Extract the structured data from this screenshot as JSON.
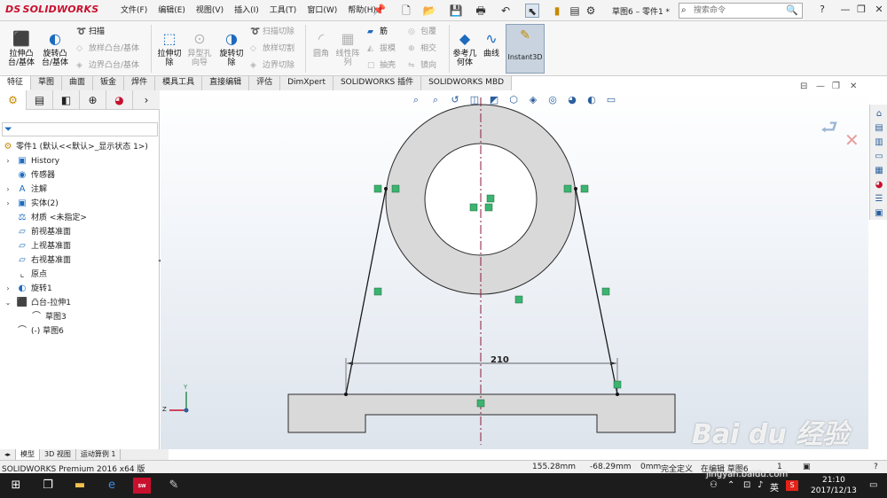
{
  "app": {
    "logo_text": "SOLIDWORKS",
    "doc_title": "草图6 – 零件1 *",
    "accent": "#c8102e"
  },
  "menu": [
    "文件(F)",
    "编辑(E)",
    "视图(V)",
    "插入(I)",
    "工具(T)",
    "窗口(W)",
    "帮助(H)"
  ],
  "search": {
    "placeholder": "搜索命令"
  },
  "ribbon": {
    "extrude_boss": "拉伸凸\n台/基体",
    "revolve_boss": "旋转凸\n台/基体",
    "sweep": "扫描",
    "loft_boss": "放样凸台/基体",
    "boundary_boss": "边界凸台/基体",
    "extrude_cut": "拉伸切\n除",
    "hole_wizard": "异型孔\n向导",
    "revolve_cut": "旋转切\n除",
    "sweep_cut": "扫描切除",
    "loft_cut": "放样切割",
    "boundary_cut": "边界切除",
    "fillet": "圆角",
    "linear_pattern": "线性阵\n列",
    "rib": "筋",
    "draft": "拔模",
    "shell": "抽壳",
    "wrap": "包覆",
    "intersect": "相交",
    "mirror": "镜向",
    "ref_geometry": "参考几\n何体",
    "curves": "曲线",
    "instant3d": "Instant3D"
  },
  "tabs": [
    "特征",
    "草图",
    "曲面",
    "钣金",
    "焊件",
    "模具工具",
    "直接编辑",
    "评估",
    "DimXpert",
    "SOLIDWORKS 插件",
    "SOLIDWORKS MBD"
  ],
  "tree": {
    "root": "零件1 (默认<<默认>_显示状态 1>)",
    "items": [
      "History",
      "传感器",
      "注解",
      "实体(2)",
      "材质 <未指定>",
      "前视基准面",
      "上视基准面",
      "右视基准面",
      "原点",
      "旋转1",
      "凸台-拉伸1",
      "草图3",
      "(-) 草图6"
    ]
  },
  "bottom_tabs": [
    "模型",
    "3D 视图",
    "运动算例 1"
  ],
  "status": {
    "app_version": "SOLIDWORKS Premium 2016 x64 版",
    "x": "155.28mm",
    "y": "-68.29mm",
    "z": "0mm",
    "state": "完全定义",
    "editing": "在编辑 草图6",
    "zoom": "1"
  },
  "sketch": {
    "dimension": "210"
  },
  "taskbar": {
    "sw_label": "SW 2016",
    "lang": "英",
    "time": "21:10",
    "date": "2017/12/13"
  },
  "watermark": {
    "text": "Bai du 经验",
    "sub": "jingyan.baidu.com"
  }
}
